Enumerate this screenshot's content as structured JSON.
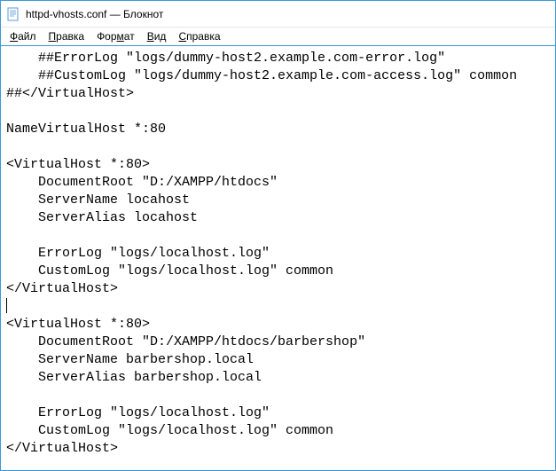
{
  "window": {
    "title": "httpd-vhosts.conf — Блокнот"
  },
  "menu": {
    "file": "Файл",
    "edit": "Правка",
    "format": "Формат",
    "view": "Вид",
    "help": "Справка"
  },
  "editor": {
    "content": "    ##ErrorLog \"logs/dummy-host2.example.com-error.log\"\n    ##CustomLog \"logs/dummy-host2.example.com-access.log\" common\n##</VirtualHost>\n\nNameVirtualHost *:80\n\n<VirtualHost *:80>\n    DocumentRoot \"D:/XAMPP/htdocs\"\n    ServerName locahost\n    ServerAlias locahost\n\n    ErrorLog \"logs/localhost.log\"\n    CustomLog \"logs/localhost.log\" common\n</VirtualHost>\n\n<VirtualHost *:80>\n    DocumentRoot \"D:/XAMPP/htdocs/barbershop\"\n    ServerName barbershop.local\n    ServerAlias barbershop.local\n\n    ErrorLog \"logs/localhost.log\"\n    CustomLog \"logs/localhost.log\" common\n</VirtualHost>"
  }
}
